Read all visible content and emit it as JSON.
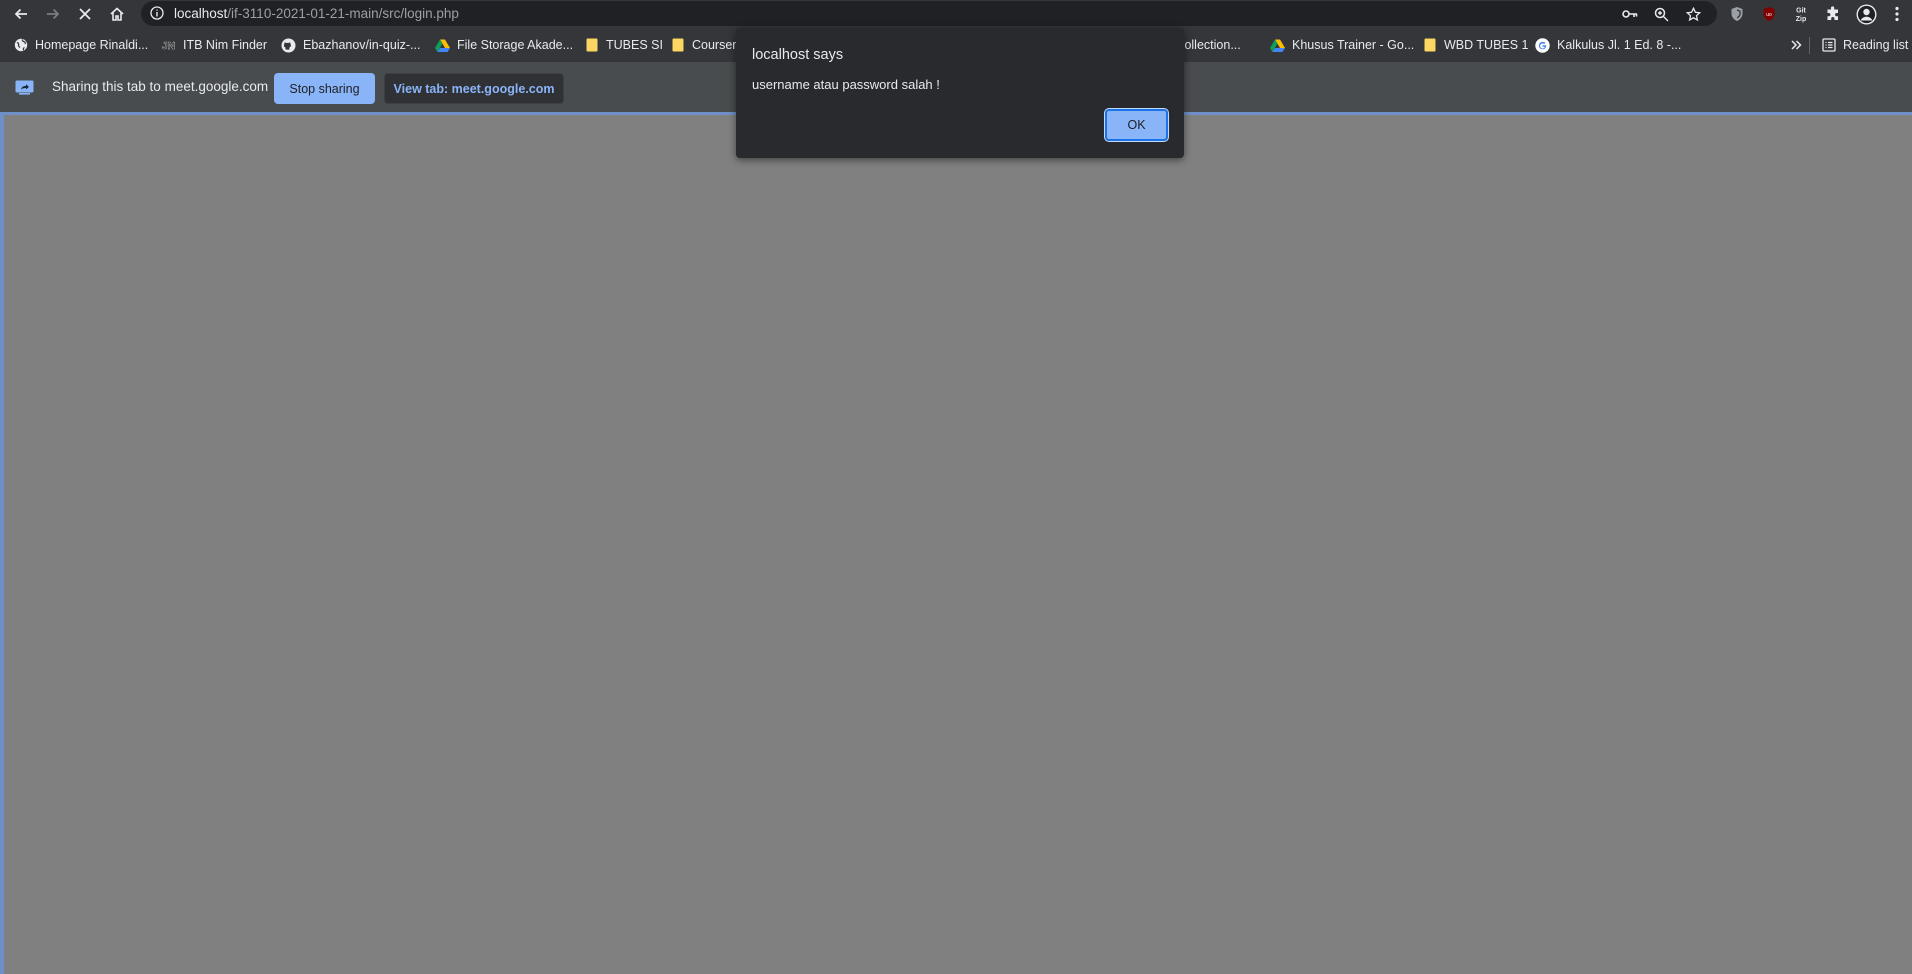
{
  "toolbar": {
    "url_host": "localhost",
    "url_path": "/if-3110-2021-01-21-main/src/login.php"
  },
  "bookmarks": {
    "items": [
      {
        "label": "Homepage Rinaldi..."
      },
      {
        "label": "ITB Nim Finder"
      },
      {
        "label": "Ebazhanov/in-quiz-..."
      },
      {
        "label": "File Storage Akade..."
      },
      {
        "label": "TUBES SI"
      },
      {
        "label": "Coursera"
      },
      {
        "label": "n Collection..."
      },
      {
        "label": "Khusus Trainer - Go..."
      },
      {
        "label": "WBD TUBES 1"
      },
      {
        "label": "Kalkulus Jl. 1 Ed. 8 -..."
      }
    ],
    "reading_list": "Reading list"
  },
  "infobar": {
    "text": "Sharing this tab to meet.google.com",
    "stop_label": "Stop sharing",
    "view_label": "View tab: meet.google.com"
  },
  "dialog": {
    "title": "localhost says",
    "message": "username atau password salah !",
    "ok_label": "OK"
  }
}
